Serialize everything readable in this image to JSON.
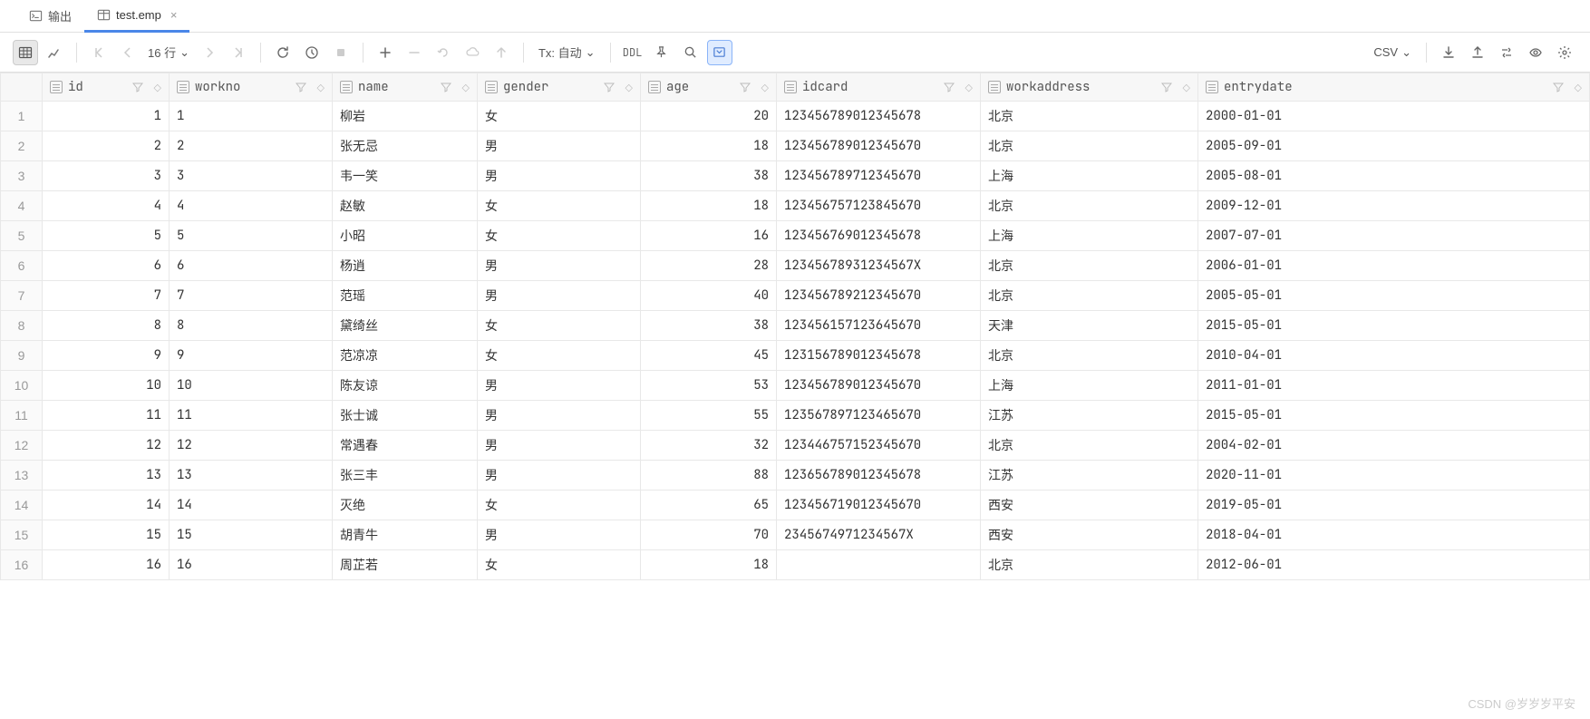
{
  "tabs": {
    "output": "输出",
    "file": "test.emp"
  },
  "toolbar": {
    "row_count": "16 行",
    "tx_label": "Tx: 自动",
    "ddl": "DDL",
    "csv": "CSV"
  },
  "columns": [
    "id",
    "workno",
    "name",
    "gender",
    "age",
    "idcard",
    "workaddress",
    "entrydate"
  ],
  "rows": [
    {
      "n": 1,
      "id": "1",
      "workno": "1",
      "name": "柳岩",
      "gender": "女",
      "age": "20",
      "idcard": "123456789012345678",
      "workaddress": "北京",
      "entrydate": "2000-01-01"
    },
    {
      "n": 2,
      "id": "2",
      "workno": "2",
      "name": "张无忌",
      "gender": "男",
      "age": "18",
      "idcard": "123456789012345670",
      "workaddress": "北京",
      "entrydate": "2005-09-01"
    },
    {
      "n": 3,
      "id": "3",
      "workno": "3",
      "name": "韦一笑",
      "gender": "男",
      "age": "38",
      "idcard": "123456789712345670",
      "workaddress": "上海",
      "entrydate": "2005-08-01"
    },
    {
      "n": 4,
      "id": "4",
      "workno": "4",
      "name": "赵敏",
      "gender": "女",
      "age": "18",
      "idcard": "12345675712384​5670",
      "workaddress": "北京",
      "entrydate": "2009-12-01"
    },
    {
      "n": 5,
      "id": "5",
      "workno": "5",
      "name": "小昭",
      "gender": "女",
      "age": "16",
      "idcard": "123456769012345678",
      "workaddress": "上海",
      "entrydate": "2007-07-01"
    },
    {
      "n": 6,
      "id": "6",
      "workno": "6",
      "name": "杨逍",
      "gender": "男",
      "age": "28",
      "idcard": "12345678931234567X",
      "workaddress": "北京",
      "entrydate": "2006-01-01"
    },
    {
      "n": 7,
      "id": "7",
      "workno": "7",
      "name": "范瑶",
      "gender": "男",
      "age": "40",
      "idcard": "123456789212345670",
      "workaddress": "北京",
      "entrydate": "2005-05-01"
    },
    {
      "n": 8,
      "id": "8",
      "workno": "8",
      "name": "黛绮丝",
      "gender": "女",
      "age": "38",
      "idcard": "123456157123645670",
      "workaddress": "天津",
      "entrydate": "2015-05-01"
    },
    {
      "n": 9,
      "id": "9",
      "workno": "9",
      "name": "范凉凉",
      "gender": "女",
      "age": "45",
      "idcard": "123156789012345678",
      "workaddress": "北京",
      "entrydate": "2010-04-01"
    },
    {
      "n": 10,
      "id": "10",
      "workno": "10",
      "name": "陈友谅",
      "gender": "男",
      "age": "53",
      "idcard": "123456789012345670",
      "workaddress": "上海",
      "entrydate": "2011-01-01"
    },
    {
      "n": 11,
      "id": "11",
      "workno": "11",
      "name": "张士诚",
      "gender": "男",
      "age": "55",
      "idcard": "123567897123465670",
      "workaddress": "江苏",
      "entrydate": "2015-05-01"
    },
    {
      "n": 12,
      "id": "12",
      "workno": "12",
      "name": "常遇春",
      "gender": "男",
      "age": "32",
      "idcard": "123446757152345670",
      "workaddress": "北京",
      "entrydate": "2004-02-01"
    },
    {
      "n": 13,
      "id": "13",
      "workno": "13",
      "name": "张三丰",
      "gender": "男",
      "age": "88",
      "idcard": "123656789012345678",
      "workaddress": "江苏",
      "entrydate": "2020-11-01"
    },
    {
      "n": 14,
      "id": "14",
      "workno": "14",
      "name": "灭绝",
      "gender": "女",
      "age": "65",
      "idcard": "123456719012345670",
      "workaddress": "西安",
      "entrydate": "2019-05-01"
    },
    {
      "n": 15,
      "id": "15",
      "workno": "15",
      "name": "胡青牛",
      "gender": "男",
      "age": "70",
      "idcard": "2345674971234567X",
      "workaddress": "西安",
      "entrydate": "2018-04-01"
    },
    {
      "n": 16,
      "id": "16",
      "workno": "16",
      "name": "周芷若",
      "gender": "女",
      "age": "18",
      "idcard": "<null>",
      "workaddress": "北京",
      "entrydate": "2012-06-01"
    }
  ],
  "watermark": "CSDN @岁岁岁平安"
}
